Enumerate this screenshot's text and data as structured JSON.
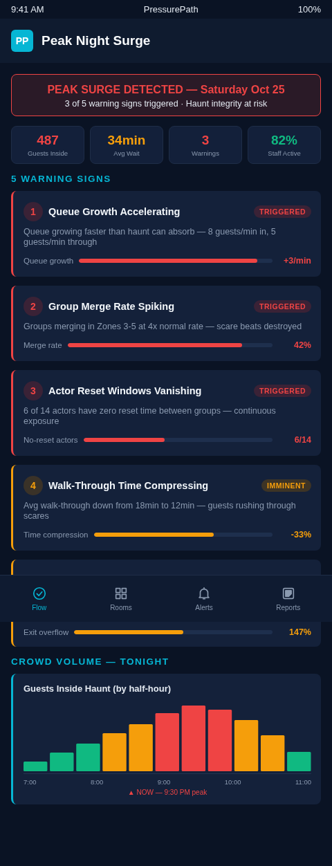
{
  "status_bar": {
    "time": "9:41 AM",
    "app": "PressurePath",
    "battery": "100%"
  },
  "header": {
    "logo": "PP",
    "title": "Peak Night Surge"
  },
  "alert": {
    "title": "PEAK SURGE DETECTED — Saturday Oct 25",
    "subtitle": "3 of 5 warning signs triggered · Haunt integrity at risk"
  },
  "stats": [
    {
      "value": "487",
      "label": "Guests Inside",
      "color": "#ef4444"
    },
    {
      "value": "34min",
      "label": "Avg Wait",
      "color": "#f59e0b"
    },
    {
      "value": "3",
      "label": "Warnings",
      "color": "#ef4444"
    },
    {
      "value": "82%",
      "label": "Staff Active",
      "color": "#10b981"
    }
  ],
  "warnings_heading": "5 WARNING SIGNS",
  "warnings": [
    {
      "kind": "triggered",
      "number": "1",
      "title": "Queue Growth Accelerating",
      "badge": "TRIGGERED",
      "description": "Queue growing faster than haunt can absorb — 8 guests/min in, 5 guests/min through",
      "metric": "Queue growth",
      "level": 0.92,
      "reading": "+3/min"
    },
    {
      "kind": "triggered",
      "number": "2",
      "title": "Group Merge Rate Spiking",
      "badge": "TRIGGERED",
      "description": "Groups merging in Zones 3-5 at 4x normal rate — scare beats destroyed",
      "metric": "Merge rate",
      "level": 0.85,
      "reading": "42%"
    },
    {
      "kind": "triggered",
      "number": "3",
      "title": "Actor Reset Windows Vanishing",
      "badge": "TRIGGERED",
      "description": "6 of 14 actors have zero reset time between groups — continuous exposure",
      "metric": "No-reset actors",
      "level": 0.43,
      "reading": "6/14"
    },
    {
      "kind": "imminent",
      "number": "4",
      "title": "Walk-Through Time Compressing",
      "badge": "IMMINENT",
      "description": "Avg walk-through down from 18min to 12min — guests rushing through scares",
      "metric": "Time compression",
      "level": 0.67,
      "reading": "-33%"
    },
    {
      "kind": "imminent",
      "metric": "Exit overflow",
      "level": 0.55,
      "reading": "147%"
    }
  ],
  "nav": [
    {
      "kind": "flow",
      "label": "Flow",
      "selected": true
    },
    {
      "kind": "rooms",
      "label": "Rooms",
      "selected": false
    },
    {
      "kind": "alerts",
      "label": "Alerts",
      "selected": false
    },
    {
      "kind": "reports",
      "label": "Reports",
      "selected": false
    }
  ],
  "volume_heading": "CROWD VOLUME — TONIGHT",
  "chart": {
    "title": "Guests Inside Haunt (by half-hour)",
    "axis_labels": [
      "7:00",
      "8:00",
      "9:00",
      "10:00",
      "11:00"
    ],
    "note": "▲ NOW — 9:30 PM peak"
  }
}
